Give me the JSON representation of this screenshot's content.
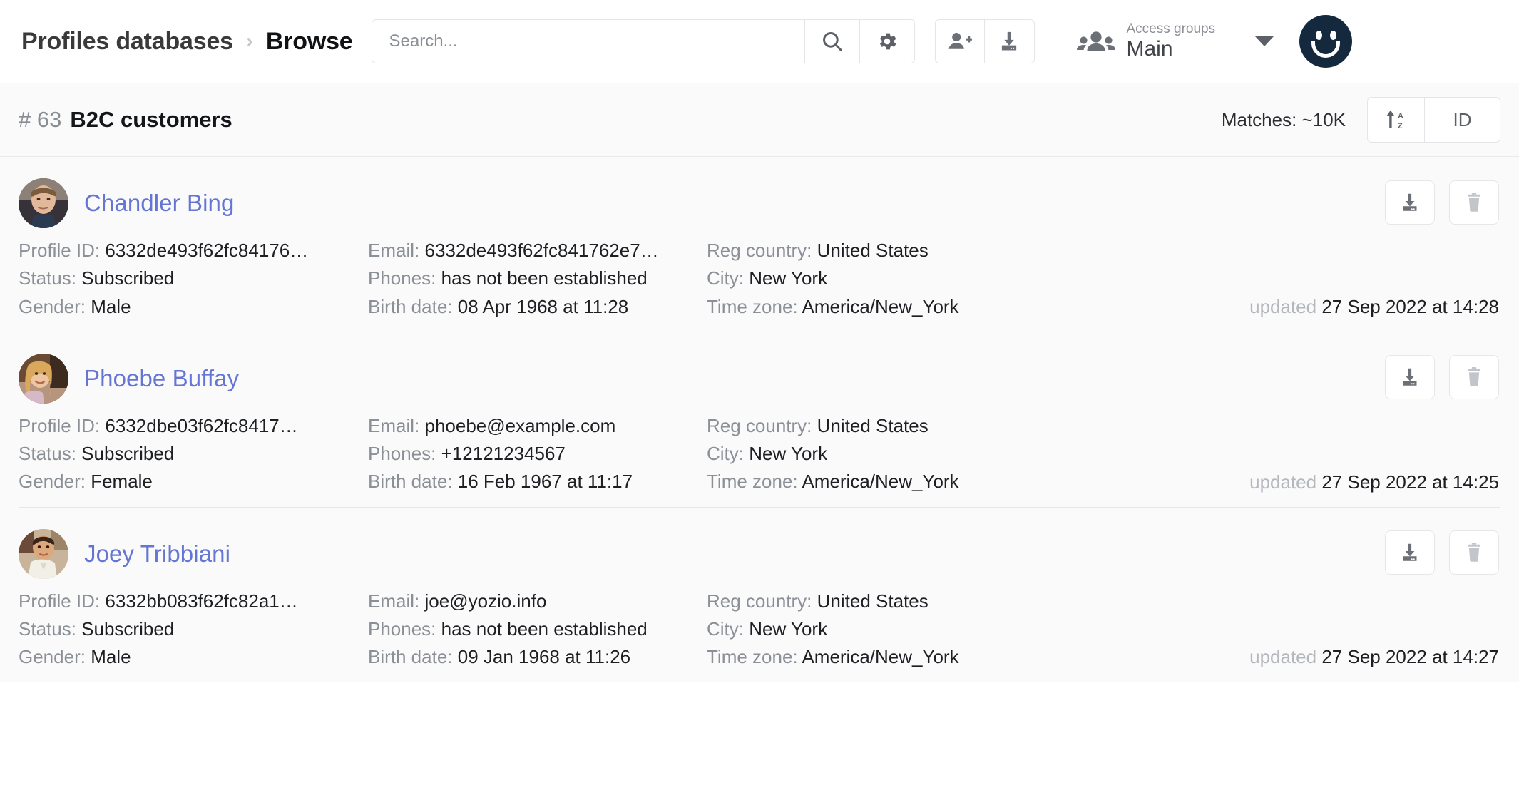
{
  "header": {
    "breadcrumb_root": "Profiles databases",
    "breadcrumb_sep": "›",
    "breadcrumb_current": "Browse",
    "search_placeholder": "Search...",
    "search_value": "",
    "access_groups_label": "Access groups",
    "access_groups_value": "Main"
  },
  "subheader": {
    "db_number": "# 63",
    "db_name": "B2C customers",
    "matches": "Matches: ~10K",
    "sort_button": "",
    "id_button": "ID"
  },
  "colors": {
    "name_link": "#6575d4",
    "label_gray": "#8b8f96",
    "value_dark": "#1d1f23",
    "avatar_bg": "#14293e",
    "page_bg": "#fafafa"
  },
  "rows": [
    {
      "name": "Chandler Bing",
      "profile_id_label": "Profile ID:",
      "profile_id": "6332de493f62fc84176…",
      "status_label": "Status:",
      "status": "Subscribed",
      "gender_label": "Gender:",
      "gender": "Male",
      "email_label": "Email:",
      "email": "6332de493f62fc841762e7…",
      "phones_label": "Phones:",
      "phones": "has not been established",
      "birth_label": "Birth date:",
      "birth": "08 Apr 1968 at 11:28",
      "country_label": "Reg country:",
      "country": "United States",
      "city_label": "City:",
      "city": "New York",
      "tz_label": "Time zone:",
      "tz": "America/New_York",
      "updated_label": "updated",
      "updated": "27 Sep 2022 at 14:28",
      "avatar_kind": "chandler"
    },
    {
      "name": "Phoebe Buffay",
      "profile_id_label": "Profile ID:",
      "profile_id": "6332dbe03f62fc8417…",
      "status_label": "Status:",
      "status": "Subscribed",
      "gender_label": "Gender:",
      "gender": "Female",
      "email_label": "Email:",
      "email": "phoebe@example.com",
      "phones_label": "Phones:",
      "phones": "+12121234567",
      "birth_label": "Birth date:",
      "birth": "16 Feb 1967 at 11:17",
      "country_label": "Reg country:",
      "country": "United States",
      "city_label": "City:",
      "city": "New York",
      "tz_label": "Time zone:",
      "tz": "America/New_York",
      "updated_label": "updated",
      "updated": "27 Sep 2022 at 14:25",
      "avatar_kind": "phoebe"
    },
    {
      "name": "Joey Tribbiani",
      "profile_id_label": "Profile ID:",
      "profile_id": "6332bb083f62fc82a1…",
      "status_label": "Status:",
      "status": "Subscribed",
      "gender_label": "Gender:",
      "gender": "Male",
      "email_label": "Email:",
      "email": "joe@yozio.info",
      "phones_label": "Phones:",
      "phones": "has not been established",
      "birth_label": "Birth date:",
      "birth": "09 Jan 1968 at 11:26",
      "country_label": "Reg country:",
      "country": "United States",
      "city_label": "City:",
      "city": "New York",
      "tz_label": "Time zone:",
      "tz": "America/New_York",
      "updated_label": "updated",
      "updated": "27 Sep 2022 at 14:27",
      "avatar_kind": "joey"
    }
  ]
}
